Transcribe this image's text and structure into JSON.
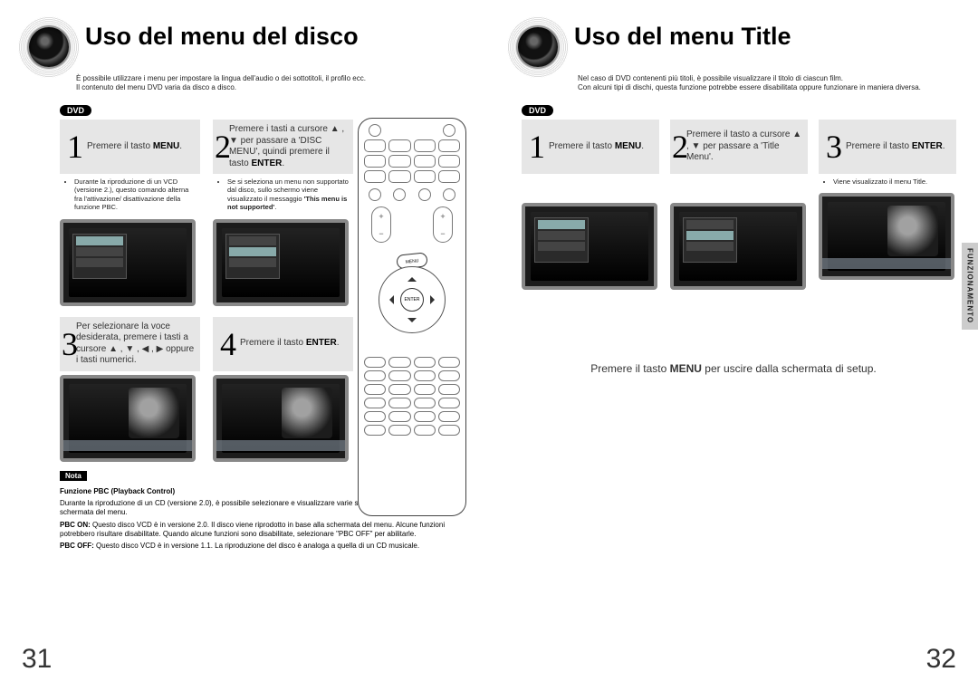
{
  "left": {
    "title": "Uso del menu del disco",
    "subtitle_line1": "È possibile utilizzare i menu per impostare la lingua dell'audio o dei sottotitoli, il profilo ecc.",
    "subtitle_line2": "Il contenuto del menu DVD varia da disco a disco.",
    "badge": "DVD",
    "steps": {
      "s1": {
        "num": "1",
        "text": "Premere il tasto <b>MENU</b>.",
        "note": "Durante la riproduzione di un VCD (versione 2.), questo comando alterna fra l'attivazione/ disattivazione della funzione PBC."
      },
      "s2": {
        "num": "2",
        "text": "Premere i tasti a cursore ▲ , ▼ per passare a 'DISC MENU', quindi premere il tasto <b>ENTER</b>.",
        "note": "Se si seleziona un menu non supportato dal disco, sullo schermo viene visualizzato il messaggio <b>'This menu is not supported'</b>."
      },
      "s3": {
        "num": "3",
        "text": "Per selezionare la voce desiderata, premere i tasti a cursore ▲ , ▼ , ◀ , ▶ oppure i tasti numerici."
      },
      "s4": {
        "num": "4",
        "text": "Premere il tasto <b>ENTER</b>."
      }
    },
    "nota_label": "Nota",
    "nota_heading": "Funzione PBC (Playback Control)",
    "nota_p1": "Durante la riproduzione di un CD (versione 2.0), è possibile selezionare e visualizzare varie scene a seconda della schermata del menu.",
    "nota_p2_label": "PBC ON:",
    "nota_p2": " Questo disco VCD è in versione 2.0. Il disco viene riprodotto in base alla schermata del menu. Alcune funzioni potrebbero risultare disabilitate. Quando alcune funzioni sono disabilitate, selezionare \"PBC OFF\" per abilitarle.",
    "nota_p3_label": "PBC OFF:",
    "nota_p3": " Questo disco VCD è in versione 1.1. La riproduzione del disco è analoga a quella di un CD musicale.",
    "page_num": "31"
  },
  "right": {
    "title": "Uso del menu Title",
    "subtitle_line1": "Nel caso di DVD contenenti più titoli, è possibile visualizzare il titolo di ciascun film.",
    "subtitle_line2": "Con alcuni tipi di dischi, questa funzione potrebbe essere disabilitata oppure funzionare in maniera diversa.",
    "badge": "DVD",
    "steps": {
      "s1": {
        "num": "1",
        "text": "Premere il tasto <b>MENU</b>."
      },
      "s2": {
        "num": "2",
        "text": "Premere il tasto a cursore ▲ , ▼ per passare a 'Title Menu'."
      },
      "s3": {
        "num": "3",
        "text": "Premere il tasto <b>ENTER</b>.",
        "note": "Viene visualizzato il menu Title."
      }
    },
    "footer": "Premere il tasto <b>MENU</b> per uscire dalla schermata di setup.",
    "side_tab": "FUNZIONAMENTO",
    "page_num": "32"
  },
  "remote": {
    "menu_label": "MENU",
    "enter_label": "ENTER"
  }
}
